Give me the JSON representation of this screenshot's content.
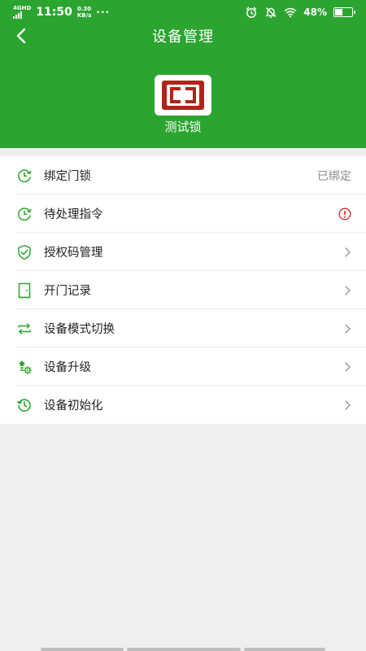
{
  "status_bar": {
    "network": "4G",
    "network_sub": "HD",
    "time": "11:50",
    "speed_value": "0.30",
    "speed_unit": "KB/s",
    "more": "···",
    "battery_percent": "48%",
    "battery_level": 0.48
  },
  "nav": {
    "title": "设备管理",
    "back_icon": "chevron-left-icon"
  },
  "device": {
    "name": "测试锁",
    "logo_color": "#b02418"
  },
  "menu": {
    "items": [
      {
        "label": "绑定门锁",
        "value": "已绑定",
        "icon": "clock-icon",
        "right": "text"
      },
      {
        "label": "待处理指令",
        "icon": "clock-icon",
        "right": "alert"
      },
      {
        "label": "授权码管理",
        "icon": "shield-check-icon",
        "right": "chevron"
      },
      {
        "label": "开门记录",
        "icon": "door-icon",
        "right": "chevron"
      },
      {
        "label": "设备模式切换",
        "icon": "switch-icon",
        "right": "chevron"
      },
      {
        "label": "设备升级",
        "icon": "upgrade-gear-icon",
        "right": "chevron"
      },
      {
        "label": "设备初始化",
        "icon": "reset-icon",
        "right": "chevron"
      }
    ]
  },
  "colors": {
    "primary": "#2ca430",
    "alert": "#d32f2f",
    "background": "#efefef"
  }
}
